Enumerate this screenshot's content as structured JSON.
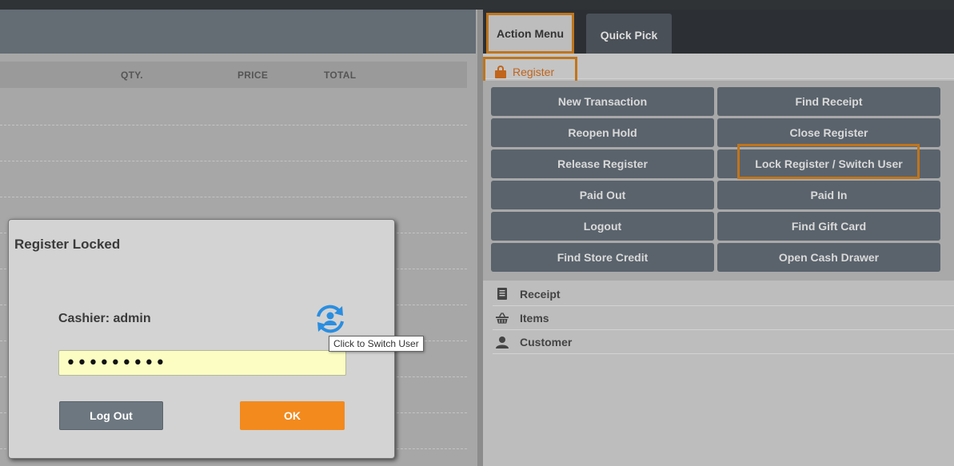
{
  "left": {
    "columns": {
      "qty": "QTY.",
      "price": "PRICE",
      "total": "TOTAL"
    }
  },
  "tabs": {
    "action_menu": "Action Menu",
    "quick_pick": "Quick Pick"
  },
  "register": {
    "label": "Register",
    "icon": "lock-icon"
  },
  "actions": [
    "New Transaction",
    "Find Receipt",
    "Reopen Hold",
    "Close Register",
    "Release Register",
    "Lock Register / Switch User",
    "Paid Out",
    "Paid In",
    "Logout",
    "Find Gift Card",
    "Find Store Credit",
    "Open Cash Drawer"
  ],
  "links": [
    {
      "label": "Receipt",
      "icon": "receipt-icon"
    },
    {
      "label": "Items",
      "icon": "basket-icon"
    },
    {
      "label": "Customer",
      "icon": "user-icon"
    }
  ],
  "modal": {
    "title": "Register Locked",
    "cashier": "Cashier: admin",
    "password_value": "•••••••••",
    "logout_label": "Log Out",
    "ok_label": "OK"
  },
  "tooltip": "Click to Switch User",
  "colors": {
    "accent": "#f28a1e",
    "highlight": "#c0751b",
    "button_dark": "#5a636c",
    "switch_icon": "#2a8ee0"
  }
}
